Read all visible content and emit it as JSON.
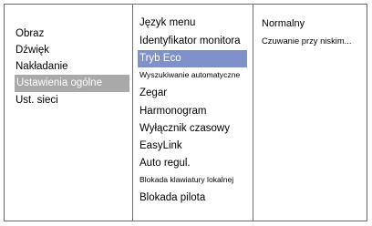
{
  "main_menu": {
    "items": [
      {
        "label": "Obraz"
      },
      {
        "label": "Dźwięk"
      },
      {
        "label": "Nakładanie"
      },
      {
        "label": "Ustawienia ogólne"
      },
      {
        "label": "Ust. sieci"
      }
    ],
    "selected": "Ustawienia ogólne"
  },
  "general_settings": {
    "items": [
      {
        "label": "Język menu"
      },
      {
        "label": "Identyfikator monitora"
      },
      {
        "label": "Tryb Eco"
      },
      {
        "label": "Wyszukiwanie automatyczne"
      },
      {
        "label": "Zegar"
      },
      {
        "label": "Harmonogram"
      },
      {
        "label": "Wyłącznik czasowy"
      },
      {
        "label": "EasyLink"
      },
      {
        "label": "Auto regul."
      },
      {
        "label": "Blokada klawiatury lokalnej"
      },
      {
        "label": "Blokada pilota"
      }
    ],
    "selected": "Tryb Eco"
  },
  "eco_options": {
    "items": [
      {
        "label": "Normalny"
      },
      {
        "label": "Czuwanie przy niskim..."
      }
    ]
  },
  "colors": {
    "highlight_main": "#a9a9a9",
    "highlight_sub": "#8090c8"
  }
}
